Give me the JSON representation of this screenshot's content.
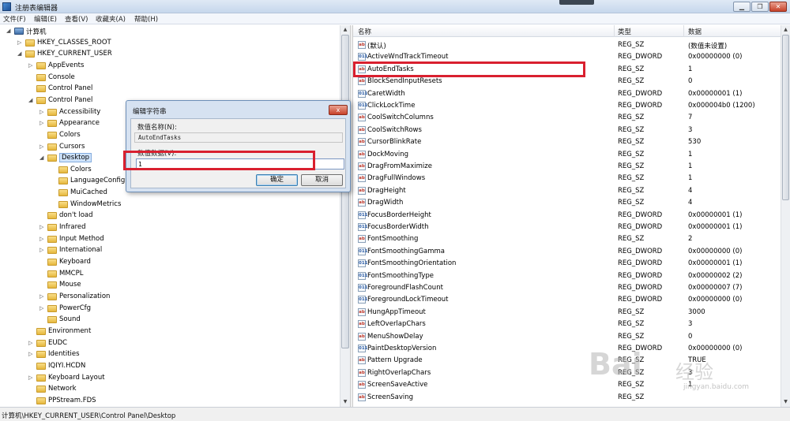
{
  "window": {
    "title": "注册表编辑器"
  },
  "menu": [
    "文件(F)",
    "编辑(E)",
    "查看(V)",
    "收藏夹(A)",
    "帮助(H)"
  ],
  "tree": [
    {
      "label": "计算机",
      "level": 0,
      "expanded": true,
      "icon": "computer-icon"
    },
    {
      "label": "HKEY_CLASSES_ROOT",
      "level": 1,
      "expanded": false
    },
    {
      "label": "HKEY_CURRENT_USER",
      "level": 1,
      "expanded": true
    },
    {
      "label": "AppEvents",
      "level": 2,
      "expanded": false
    },
    {
      "label": "Console",
      "level": 2,
      "expanded": null
    },
    {
      "label": "Control   Panel",
      "level": 2,
      "expanded": null
    },
    {
      "label": "Control Panel",
      "level": 2,
      "expanded": true
    },
    {
      "label": "Accessibility",
      "level": 3,
      "expanded": false
    },
    {
      "label": "Appearance",
      "level": 3,
      "expanded": false
    },
    {
      "label": "Colors",
      "level": 3,
      "expanded": null
    },
    {
      "label": "Cursors",
      "level": 3,
      "expanded": false
    },
    {
      "label": "Desktop",
      "level": 3,
      "expanded": true,
      "selected": true
    },
    {
      "label": "Colors",
      "level": 4,
      "expanded": null
    },
    {
      "label": "LanguageConfiguration",
      "level": 4,
      "expanded": null
    },
    {
      "label": "MuiCached",
      "level": 4,
      "expanded": null
    },
    {
      "label": "WindowMetrics",
      "level": 4,
      "expanded": null
    },
    {
      "label": "don't load",
      "level": 3,
      "expanded": null
    },
    {
      "label": "Infrared",
      "level": 3,
      "expanded": false
    },
    {
      "label": "Input Method",
      "level": 3,
      "expanded": false
    },
    {
      "label": "International",
      "level": 3,
      "expanded": false
    },
    {
      "label": "Keyboard",
      "level": 3,
      "expanded": null
    },
    {
      "label": "MMCPL",
      "level": 3,
      "expanded": null
    },
    {
      "label": "Mouse",
      "level": 3,
      "expanded": null
    },
    {
      "label": "Personalization",
      "level": 3,
      "expanded": false
    },
    {
      "label": "PowerCfg",
      "level": 3,
      "expanded": false
    },
    {
      "label": "Sound",
      "level": 3,
      "expanded": null
    },
    {
      "label": "Environment",
      "level": 2,
      "expanded": null
    },
    {
      "label": "EUDC",
      "level": 2,
      "expanded": false
    },
    {
      "label": "Identities",
      "level": 2,
      "expanded": false
    },
    {
      "label": "IQIYI.HCDN",
      "level": 2,
      "expanded": null
    },
    {
      "label": "Keyboard Layout",
      "level": 2,
      "expanded": false
    },
    {
      "label": "Network",
      "level": 2,
      "expanded": null
    },
    {
      "label": "PPStream.FDS",
      "level": 2,
      "expanded": null
    }
  ],
  "list": {
    "columns": {
      "name": "名称",
      "type": "类型",
      "data": "数据"
    },
    "rows": [
      {
        "icon": "ab",
        "name": "(默认)",
        "type": "REG_SZ",
        "data": "(数值未设置)"
      },
      {
        "icon": "dw",
        "name": "ActiveWndTrackTimeout",
        "type": "REG_DWORD",
        "data": "0x00000000 (0)"
      },
      {
        "icon": "ab",
        "name": "AutoEndTasks",
        "type": "REG_SZ",
        "data": "1"
      },
      {
        "icon": "ab",
        "name": "BlockSendInputResets",
        "type": "REG_SZ",
        "data": "0"
      },
      {
        "icon": "dw",
        "name": "CaretWidth",
        "type": "REG_DWORD",
        "data": "0x00000001 (1)"
      },
      {
        "icon": "dw",
        "name": "ClickLockTime",
        "type": "REG_DWORD",
        "data": "0x000004b0 (1200)"
      },
      {
        "icon": "ab",
        "name": "CoolSwitchColumns",
        "type": "REG_SZ",
        "data": "7"
      },
      {
        "icon": "ab",
        "name": "CoolSwitchRows",
        "type": "REG_SZ",
        "data": "3"
      },
      {
        "icon": "ab",
        "name": "CursorBlinkRate",
        "type": "REG_SZ",
        "data": "530"
      },
      {
        "icon": "ab",
        "name": "DockMoving",
        "type": "REG_SZ",
        "data": "1"
      },
      {
        "icon": "ab",
        "name": "DragFromMaximize",
        "type": "REG_SZ",
        "data": "1"
      },
      {
        "icon": "ab",
        "name": "DragFullWindows",
        "type": "REG_SZ",
        "data": "1"
      },
      {
        "icon": "ab",
        "name": "DragHeight",
        "type": "REG_SZ",
        "data": "4"
      },
      {
        "icon": "ab",
        "name": "DragWidth",
        "type": "REG_SZ",
        "data": "4"
      },
      {
        "icon": "dw",
        "name": "FocusBorderHeight",
        "type": "REG_DWORD",
        "data": "0x00000001 (1)"
      },
      {
        "icon": "dw",
        "name": "FocusBorderWidth",
        "type": "REG_DWORD",
        "data": "0x00000001 (1)"
      },
      {
        "icon": "ab",
        "name": "FontSmoothing",
        "type": "REG_SZ",
        "data": "2"
      },
      {
        "icon": "dw",
        "name": "FontSmoothingGamma",
        "type": "REG_DWORD",
        "data": "0x00000000 (0)"
      },
      {
        "icon": "dw",
        "name": "FontSmoothingOrientation",
        "type": "REG_DWORD",
        "data": "0x00000001 (1)"
      },
      {
        "icon": "dw",
        "name": "FontSmoothingType",
        "type": "REG_DWORD",
        "data": "0x00000002 (2)"
      },
      {
        "icon": "dw",
        "name": "ForegroundFlashCount",
        "type": "REG_DWORD",
        "data": "0x00000007 (7)"
      },
      {
        "icon": "dw",
        "name": "ForegroundLockTimeout",
        "type": "REG_DWORD",
        "data": "0x00000000 (0)"
      },
      {
        "icon": "ab",
        "name": "HungAppTimeout",
        "type": "REG_SZ",
        "data": "3000"
      },
      {
        "icon": "ab",
        "name": "LeftOverlapChars",
        "type": "REG_SZ",
        "data": "3"
      },
      {
        "icon": "ab",
        "name": "MenuShowDelay",
        "type": "REG_SZ",
        "data": "0"
      },
      {
        "icon": "dw",
        "name": "PaintDesktopVersion",
        "type": "REG_DWORD",
        "data": "0x00000000 (0)"
      },
      {
        "icon": "ab",
        "name": "Pattern Upgrade",
        "type": "REG_SZ",
        "data": "TRUE"
      },
      {
        "icon": "ab",
        "name": "RightOverlapChars",
        "type": "REG_SZ",
        "data": "3"
      },
      {
        "icon": "ab",
        "name": "ScreenSaveActive",
        "type": "REG_SZ",
        "data": "1"
      },
      {
        "icon": "ab",
        "name": "ScreenSaving",
        "type": "REG_SZ",
        "data": ""
      }
    ]
  },
  "status": "计算机\\HKEY_CURRENT_USER\\Control Panel\\Desktop",
  "dialog": {
    "title": "编辑字符串",
    "close_label": "x",
    "name_label": "数值名称(N):",
    "name_value": "AutoEndTasks",
    "data_label": "数值数据(V):",
    "data_value": "1",
    "ok_label": "确定",
    "cancel_label": "取消"
  },
  "watermark": {
    "brand": "Bai",
    "sub": "经验",
    "url": "jingyan.baidu.com"
  },
  "colors": {
    "highlight": "#d9202f",
    "selection": "#cfe3fb",
    "titlebar": "#c6d7ec"
  }
}
